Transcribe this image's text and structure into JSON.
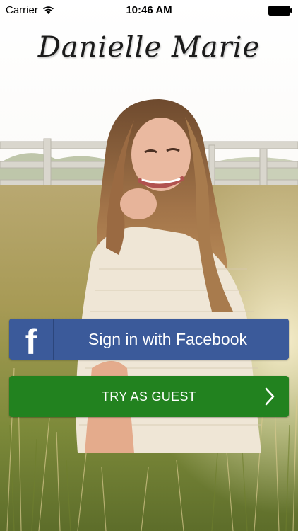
{
  "status_bar": {
    "carrier": "Carrier",
    "time": "10:46 AM",
    "wifi_icon": "wifi-icon",
    "battery_icon": "battery-icon"
  },
  "header": {
    "title": "Danielle Marie"
  },
  "buttons": {
    "facebook": {
      "label": "Sign in with Facebook",
      "icon": "facebook-icon",
      "icon_glyph": "f",
      "color": "#3b5a9a"
    },
    "guest": {
      "label": "TRY AS GUEST",
      "icon": "chevron-right-icon",
      "color": "#22821f"
    }
  },
  "background": {
    "description_icon": "background-photo"
  }
}
